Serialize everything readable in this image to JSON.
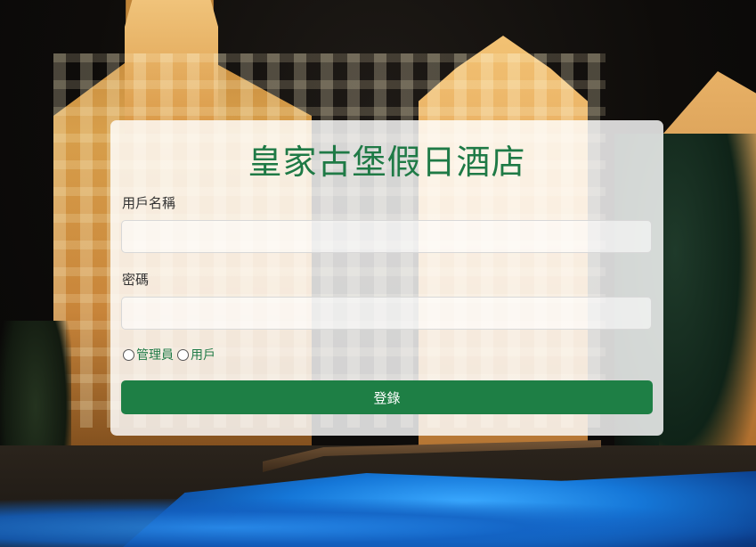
{
  "app": {
    "title": "皇家古堡假日酒店"
  },
  "form": {
    "username_label": "用戶名稱",
    "username_value": "",
    "password_label": "密碼",
    "password_value": "",
    "roles": [
      {
        "label": "管理員",
        "checked": false
      },
      {
        "label": "用戶",
        "checked": false
      }
    ],
    "login_label": "登錄"
  },
  "colors": {
    "accent": "#1e7f45",
    "title": "#1f7a46"
  },
  "icons": {
    "radio": "radio-circle-icon"
  }
}
